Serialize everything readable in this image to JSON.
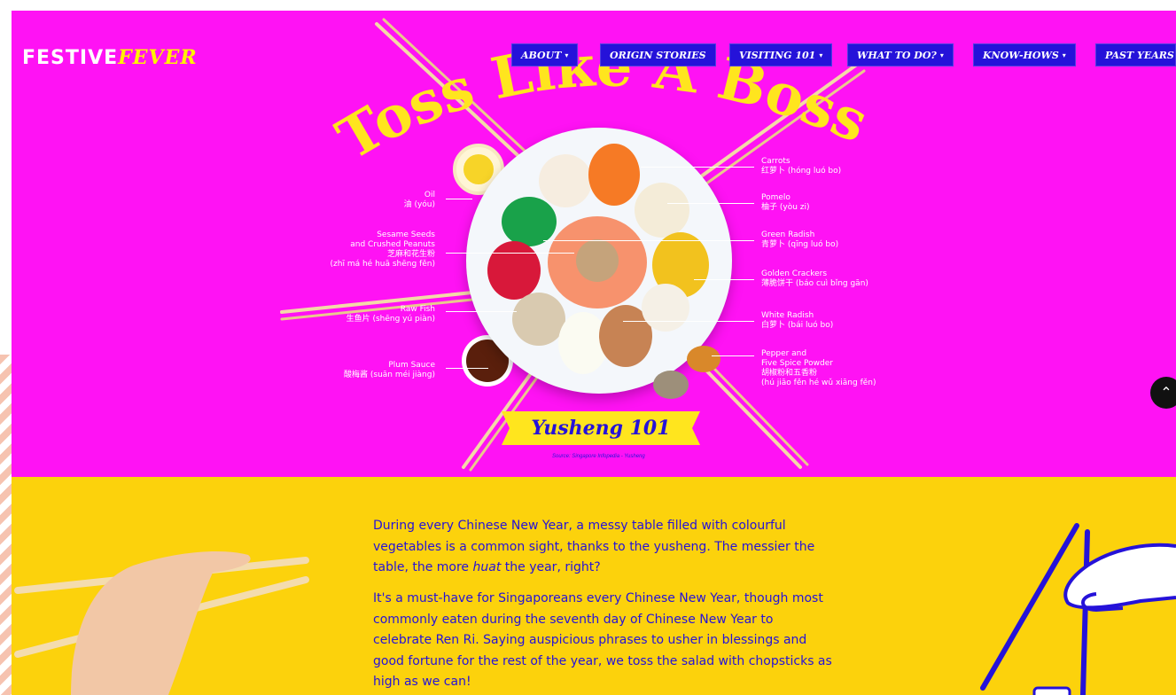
{
  "logo": {
    "part1": "FESTIVE",
    "part2": "FEVER"
  },
  "nav": [
    {
      "label": "ABOUT",
      "caret": "▾"
    },
    {
      "label": "ORIGIN STORIES",
      "caret": ""
    },
    {
      "label": "VISITING 101",
      "caret": "▾"
    },
    {
      "label": "WHAT TO DO?",
      "caret": "▾"
    },
    {
      "label": "KNOW-HOWS",
      "caret": "▾"
    },
    {
      "label": "PAST YEARS",
      "caret": ""
    }
  ],
  "hero": {
    "title": "Toss Like A Boss",
    "banner": "Yusheng 101",
    "source": "Source: Singapore Infopedia - Yusheng"
  },
  "ingredients_left": [
    {
      "en": "Oil",
      "zh": "油 (yóu)"
    },
    {
      "en": "Sesame Seeds",
      "en2": "and Crushed Peanuts",
      "zh": "芝麻和花生粉",
      "pinyin": "(zhī má hé huā shēng fěn)"
    },
    {
      "en": "Raw Fish",
      "zh": "生鱼片 (shēng yú piàn)"
    },
    {
      "en": "Plum Sauce",
      "zh": "酸梅酱 (suān méi jiàng)"
    }
  ],
  "ingredients_right": [
    {
      "en": "Carrots",
      "zh": "红萝卜 (hóng luó bo)"
    },
    {
      "en": "Pomelo",
      "zh": "柚子 (yòu zi)"
    },
    {
      "en": "Green Radish",
      "zh": "青萝卜 (qīng luó bo)"
    },
    {
      "en": "Golden Crackers",
      "zh": "薄脆饼干 (báo cuì bǐng gān)"
    },
    {
      "en": "White Radish",
      "zh": "白萝卜 (bái luó bo)"
    },
    {
      "en": "Pepper and",
      "en2": "Five Spice Powder",
      "zh": "胡椒粉和五香粉",
      "pinyin": "(hú jiāo fěn hé wǔ xiāng fěn)"
    }
  ],
  "scroll_top": {
    "icon": "chevron-up-icon",
    "glyph": "⌃"
  },
  "article": {
    "p1_before": "During every Chinese New Year, a messy table filled with colourful vegetables is a common sight, thanks to the yusheng. The messier the table, the more ",
    "p1_em": "huat",
    "p1_after": " the year, right?",
    "p2": "It's a must-have for Singaporeans every Chinese New Year, though most commonly eaten during the seventh day of Chinese New Year to celebrate Ren Ri. Saying auspicious phrases to usher in blessings and good fortune for the rest of the year, we toss the salad with chopsticks as high as we can!"
  },
  "colors": {
    "hero_bg": "#ff12f4",
    "lower_bg": "#fcd20c",
    "nav_bg": "#2512d9",
    "title_yellow": "#ffe51e",
    "text_blue": "#2512d9"
  }
}
